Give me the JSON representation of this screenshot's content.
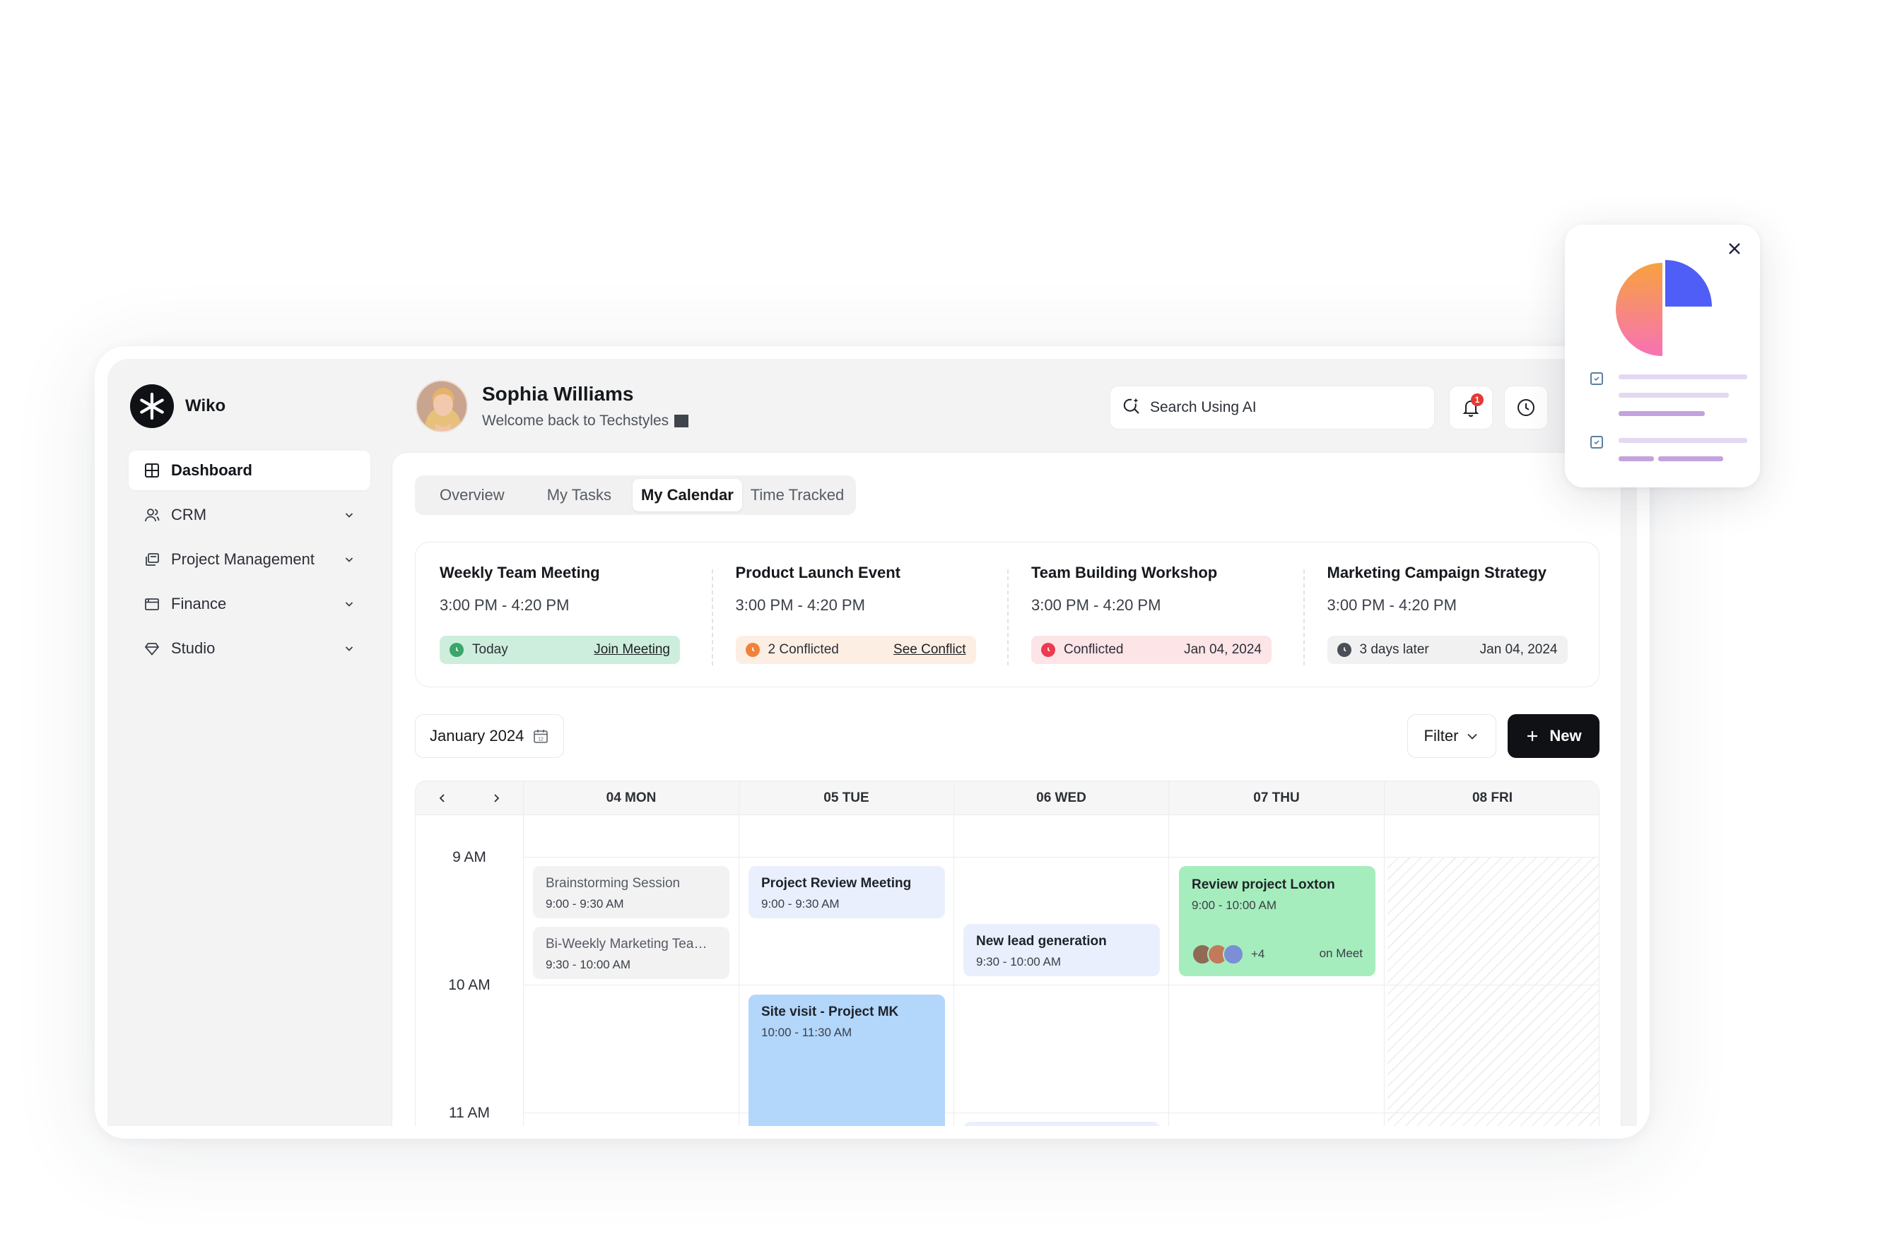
{
  "app": {
    "name": "Wiko"
  },
  "sidebar": {
    "items": [
      {
        "label": "Dashboard",
        "icon": "grid-icon",
        "active": true
      },
      {
        "label": "CRM",
        "icon": "users-icon"
      },
      {
        "label": "Project Management",
        "icon": "folders-icon"
      },
      {
        "label": "Finance",
        "icon": "wallet-icon"
      },
      {
        "label": "Studio",
        "icon": "diamond-icon"
      }
    ]
  },
  "header": {
    "user_name": "Sophia Williams",
    "welcome": "Welcome back to Techstyles",
    "search_placeholder": "Search Using AI",
    "notification_count": "1"
  },
  "tabs": [
    {
      "label": "Overview"
    },
    {
      "label": "My Tasks"
    },
    {
      "label": "My Calendar",
      "active": true
    },
    {
      "label": "Time Tracked"
    }
  ],
  "events": [
    {
      "title": "Weekly Team Meeting",
      "time": "3:00 PM - 4:20 PM",
      "status": "Today",
      "action": "Join Meeting",
      "status_color": "#3aa66a",
      "bg": "#cdeedc"
    },
    {
      "title": "Product Launch Event",
      "time": "3:00 PM - 4:20 PM",
      "status": "2 Conflicted",
      "action": "See Conflict",
      "status_color": "#f2813b",
      "bg": "#fdeee4"
    },
    {
      "title": "Team Building Workshop",
      "time": "3:00 PM - 4:20 PM",
      "status": "Conflicted",
      "date": "Jan 04, 2024",
      "status_color": "#ec3b4f",
      "bg": "#fde4e7"
    },
    {
      "title": "Marketing Campaign Strategy",
      "time": "3:00 PM - 4:20 PM",
      "status": "3 days later",
      "date": "Jan 04, 2024",
      "status_color": "#4a4f57",
      "bg": "#f1f1f2"
    }
  ],
  "calendar": {
    "month": "January 2024",
    "filter_label": "Filter",
    "new_label": "New",
    "days": [
      "04 MON",
      "05 TUE",
      "06 WED",
      "07 THU",
      "08 FRI"
    ],
    "times": [
      "9 AM",
      "10 AM",
      "11 AM"
    ],
    "appointments": [
      {
        "title": "Brainstorming Session",
        "time": "9:00 - 9:30 AM"
      },
      {
        "title": "Bi-Weekly Marketing Team Meeting",
        "time": "9:30 - 10:00 AM"
      },
      {
        "title": "Project Review Meeting",
        "time": "9:00 - 9:30 AM"
      },
      {
        "title": "Site visit - Project MK",
        "time": "10:00 - 11:30 AM"
      },
      {
        "title": "New lead generation",
        "time": "9:30 - 10:00 AM"
      },
      {
        "title": "Review project Loxton",
        "time": "9:00 - 10:00 AM",
        "more": "+4",
        "location": "on Meet"
      }
    ]
  },
  "colors": {
    "accent_dark": "#0f1114",
    "pie_orange": "#f7a23e",
    "pie_pink": "#f772b5",
    "pie_blue": "#4f5ef7",
    "widget_line": "#e3d9f2",
    "widget_line_strong": "#c4a2dc"
  }
}
